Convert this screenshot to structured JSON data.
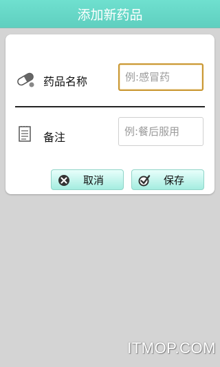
{
  "header": {
    "title": "添加新药品"
  },
  "form": {
    "medicine_name": {
      "label": "药品名称",
      "placeholder": "例:感冒药",
      "value": ""
    },
    "note": {
      "label": "备注",
      "placeholder": "例:餐后服用",
      "value": ""
    }
  },
  "buttons": {
    "cancel": "取消",
    "save": "保存"
  },
  "watermark": "ITMOP.COM",
  "colors": {
    "header": "#6fe0cf",
    "button": "#a4ece0",
    "focus_border": "#c9962f"
  }
}
